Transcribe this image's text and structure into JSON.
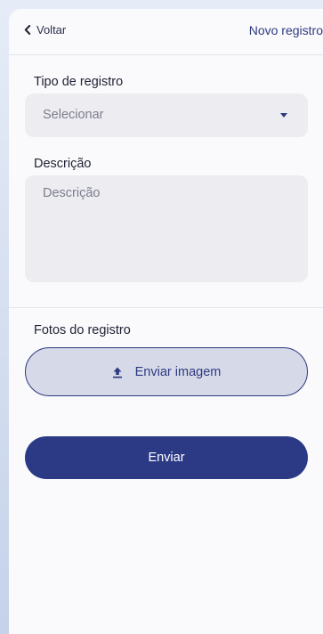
{
  "header": {
    "back_label": "Voltar",
    "title": "Novo registro"
  },
  "form": {
    "type_label": "Tipo de registro",
    "type_value": "Selecionar",
    "description_label": "Descrição",
    "description_placeholder": "Descrição",
    "photos_label": "Fotos do registro",
    "upload_label": "Enviar imagem",
    "submit_label": "Enviar"
  },
  "icons": {
    "back": "chevron-left-icon",
    "dropdown": "caret-down-icon",
    "upload": "upload-icon"
  },
  "colors": {
    "primary": "#2c3a86",
    "field_bg": "#ececf1",
    "upload_bg": "#d6d9e8"
  }
}
